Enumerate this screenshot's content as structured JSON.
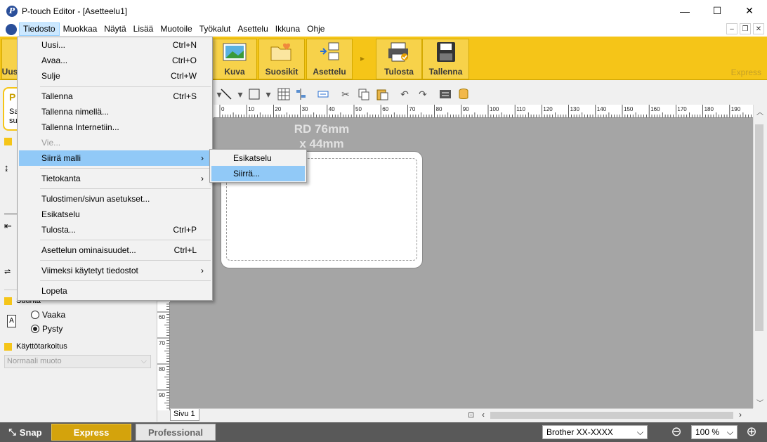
{
  "window": {
    "title": "P-touch Editor - [Asetteelu1]",
    "app_icon": "P",
    "minimize_glyph": "—",
    "maximize_glyph": "☐",
    "close_glyph": "✕",
    "mdi_minimize_glyph": "–",
    "mdi_restore_glyph": "❐",
    "mdi_close_glyph": "✕"
  },
  "menubar": {
    "items": [
      "Tiedosto",
      "Muokkaa",
      "Näytä",
      "Lisää",
      "Muotoile",
      "Työkalut",
      "Asettelu",
      "Ikkuna",
      "Ohje"
    ]
  },
  "ribbon": {
    "new_label": "Uus",
    "image_label": "Kuva",
    "favorites_label": "Suosikit",
    "layout_label": "Asettelu",
    "more_glyph": "▸",
    "print_label": "Tulosta",
    "save_label": "Tallenna",
    "mode_label": "Express"
  },
  "file_menu": {
    "items": [
      {
        "label": "Uusi...",
        "shortcut": "Ctrl+N"
      },
      {
        "label": "Avaa...",
        "shortcut": "Ctrl+O"
      },
      {
        "label": "Sulje",
        "shortcut": "Ctrl+W"
      },
      {
        "label": "Tallenna",
        "shortcut": "Ctrl+S"
      },
      {
        "label": "Tallenna nimellä...",
        "shortcut": ""
      },
      {
        "label": "Tallenna Internetiin...",
        "shortcut": ""
      },
      {
        "label": "Vie...",
        "shortcut": ""
      },
      {
        "label": "Siirrä malli",
        "shortcut": "",
        "submenu": true
      },
      {
        "label": "Tietokanta",
        "shortcut": "",
        "submenu": true
      },
      {
        "label": "Tulostimen/sivun asetukset...",
        "shortcut": ""
      },
      {
        "label": "Esikatselu",
        "shortcut": ""
      },
      {
        "label": "Tulosta...",
        "shortcut": "Ctrl+P"
      },
      {
        "label": "Asettelun ominaisuudet...",
        "shortcut": "Ctrl+L"
      },
      {
        "label": "Viimeksi käytetyt tiedostot",
        "shortcut": "",
        "submenu": true
      },
      {
        "label": "Lopeta",
        "shortcut": ""
      }
    ],
    "submenu_arrow": "›"
  },
  "transfer_submenu": {
    "items": [
      "Esikatselu",
      "Siirrä..."
    ]
  },
  "left_panel": {
    "card_title": "P",
    "card_line1": "Sa",
    "card_line2": "su",
    "orientation_header": "Suunta",
    "orientation_icon": "A",
    "orientation_options": [
      "Vaaka",
      "Pysty"
    ],
    "orientation_selected": "Pysty",
    "purpose_header": "Käyttötarkoitus",
    "purpose_value": "Normaali muoto",
    "purpose_chevron": "⌵"
  },
  "canvas": {
    "media_line1": "RD 76mm",
    "media_line2": "x 44mm",
    "page_tab": "Sivu 1"
  },
  "ruler": {
    "h_labels": [
      "0",
      "10",
      "20",
      "30",
      "40",
      "50",
      "60",
      "70",
      "80",
      "90",
      "100",
      "110",
      "120",
      "130",
      "140",
      "150",
      "160",
      "170",
      "180",
      "190"
    ],
    "v_labels": [
      "60",
      "70",
      "80",
      "90"
    ]
  },
  "statusbar": {
    "snap_label": "Snap",
    "express_label": "Express",
    "professional_label": "Professional",
    "printer": "Brother XX-XXXX",
    "zoom": "100 %",
    "zoom_out_glyph": "⊖",
    "zoom_in_glyph": "⊕",
    "chevron": "⌵"
  },
  "colors": {
    "ribbon_yellow": "#f5c518",
    "statusbar_gray": "#595959",
    "menu_highlight": "#91c9f7",
    "canvas_gray": "#a5a5a5"
  }
}
